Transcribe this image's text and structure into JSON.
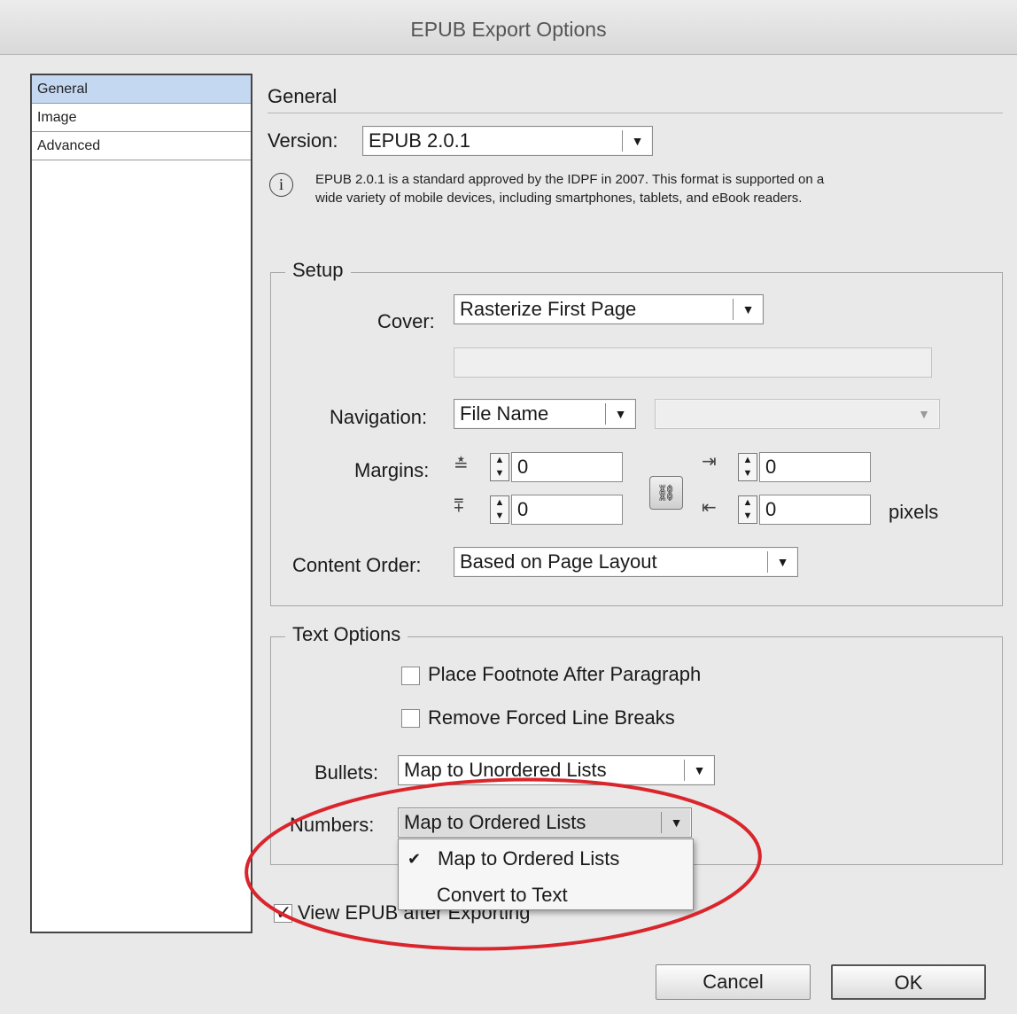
{
  "window": {
    "title": "EPUB Export Options"
  },
  "sidebar": {
    "items": [
      {
        "label": "General"
      },
      {
        "label": "Image"
      },
      {
        "label": "Advanced"
      }
    ]
  },
  "general": {
    "heading": "General",
    "version_label": "Version:",
    "version_value": "EPUB 2.0.1",
    "info_line1": "EPUB 2.0.1 is a standard approved by the IDPF in 2007. This format is supported on a",
    "info_line2": "wide variety of mobile devices, including smartphones, tablets, and eBook readers."
  },
  "setup": {
    "legend": "Setup",
    "cover_label": "Cover:",
    "cover_value": "Rasterize First Page",
    "navigation_label": "Navigation:",
    "navigation_value": "File Name",
    "margins_label": "Margins:",
    "margin_top": "0",
    "margin_bottom": "0",
    "margin_left": "0",
    "margin_right": "0",
    "units": "pixels",
    "content_order_label": "Content Order:",
    "content_order_value": "Based on Page Layout"
  },
  "text_options": {
    "legend": "Text Options",
    "footnote_label": "Place Footnote After Paragraph",
    "footnote_checked": false,
    "line_breaks_label": "Remove Forced Line Breaks",
    "line_breaks_checked": false,
    "bullets_label": "Bullets:",
    "bullets_value": "Map to Unordered Lists",
    "numbers_label": "Numbers:",
    "numbers_value": "Map to Ordered Lists"
  },
  "numbers_menu": {
    "options": [
      {
        "label": "Map to Ordered Lists",
        "selected": true
      },
      {
        "label": "Convert to Text",
        "selected": false
      }
    ]
  },
  "view_after_export": {
    "label": "View EPUB after Exporting",
    "checked": true
  },
  "buttons": {
    "cancel": "Cancel",
    "ok": "OK"
  },
  "icons": {
    "dropdown": "chevron-down-icon",
    "info": "info-icon",
    "link": "chain-link-icon",
    "stepper": "up-down-stepper-icon"
  },
  "colors": {
    "selection": "#c5d8f2",
    "annotation": "#d9262d"
  }
}
